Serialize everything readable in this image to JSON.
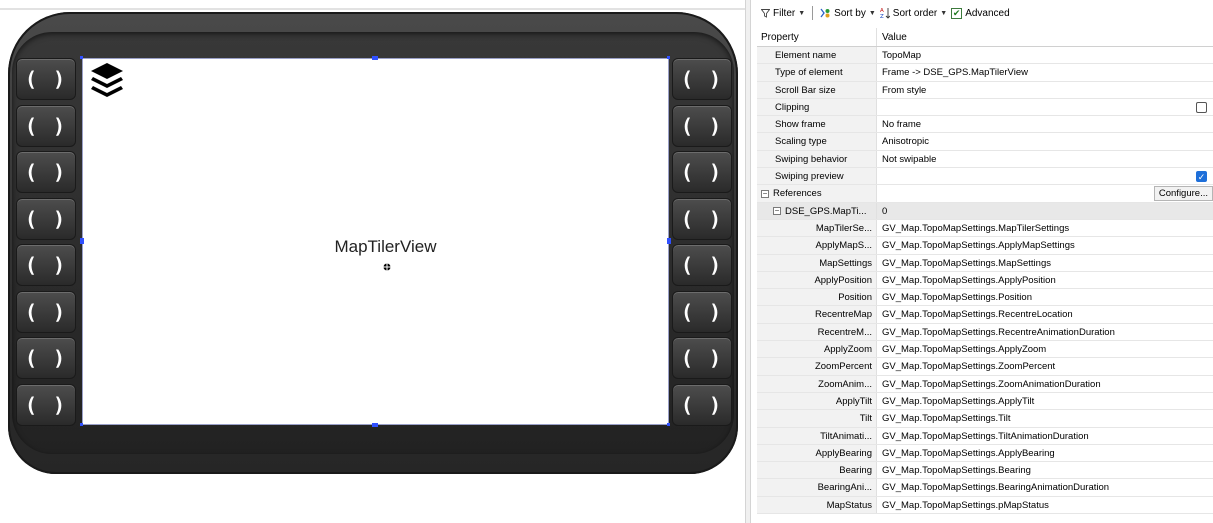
{
  "designer": {
    "view_label": "MapTilerView",
    "side_button_label": "( )",
    "left_buttons": [
      "( )",
      "( )",
      "( )",
      "( )",
      "( )",
      "( )",
      "( )",
      "( )"
    ],
    "right_buttons": [
      "( )",
      "( )",
      "( )",
      "( )",
      "( )",
      "( )",
      "( )",
      "( )"
    ]
  },
  "toolbar": {
    "filter_label": "Filter",
    "sort_by_label": "Sort by",
    "sort_order_label": "Sort order",
    "advanced_label": "Advanced",
    "advanced_checked": true
  },
  "grid": {
    "header_property": "Property",
    "header_value": "Value",
    "rows": [
      {
        "name": "Element name",
        "value": "TopoMap"
      },
      {
        "name": "Type of element",
        "value": "Frame -> DSE_GPS.MapTilerView"
      },
      {
        "name": "Scroll Bar size",
        "value": "From style"
      },
      {
        "name": "Clipping",
        "value": "",
        "checkbox": false
      },
      {
        "name": "Show frame",
        "value": "No frame"
      },
      {
        "name": "Scaling type",
        "value": "Anisotropic"
      },
      {
        "name": "Swiping behavior",
        "value": "Not swipable"
      },
      {
        "name": "Swiping preview",
        "value": "",
        "checkbox": true
      }
    ],
    "references_label": "References",
    "configure_label": "Configure...",
    "ref_group_name": "DSE_GPS.MapTi...",
    "ref_group_value": "0",
    "ref_rows": [
      {
        "name": "MapTilerSe...",
        "value": "GV_Map.TopoMapSettings.MapTilerSettings"
      },
      {
        "name": "ApplyMapS...",
        "value": "GV_Map.TopoMapSettings.ApplyMapSettings"
      },
      {
        "name": "MapSettings",
        "value": "GV_Map.TopoMapSettings.MapSettings"
      },
      {
        "name": "ApplyPosition",
        "value": "GV_Map.TopoMapSettings.ApplyPosition"
      },
      {
        "name": "Position",
        "value": "GV_Map.TopoMapSettings.Position"
      },
      {
        "name": "RecentreMap",
        "value": "GV_Map.TopoMapSettings.RecentreLocation"
      },
      {
        "name": "RecentreM...",
        "value": "GV_Map.TopoMapSettings.RecentreAnimationDuration"
      },
      {
        "name": "ApplyZoom",
        "value": "GV_Map.TopoMapSettings.ApplyZoom"
      },
      {
        "name": "ZoomPercent",
        "value": "GV_Map.TopoMapSettings.ZoomPercent"
      },
      {
        "name": "ZoomAnim...",
        "value": "GV_Map.TopoMapSettings.ZoomAnimationDuration"
      },
      {
        "name": "ApplyTilt",
        "value": "GV_Map.TopoMapSettings.ApplyTilt"
      },
      {
        "name": "Tilt",
        "value": "GV_Map.TopoMapSettings.Tilt"
      },
      {
        "name": "TiltAnimati...",
        "value": "GV_Map.TopoMapSettings.TiltAnimationDuration"
      },
      {
        "name": "ApplyBearing",
        "value": "GV_Map.TopoMapSettings.ApplyBearing"
      },
      {
        "name": "Bearing",
        "value": "GV_Map.TopoMapSettings.Bearing"
      },
      {
        "name": "BearingAni...",
        "value": "GV_Map.TopoMapSettings.BearingAnimationDuration"
      },
      {
        "name": "MapStatus",
        "value": "GV_Map.TopoMapSettings.pMapStatus"
      }
    ]
  }
}
